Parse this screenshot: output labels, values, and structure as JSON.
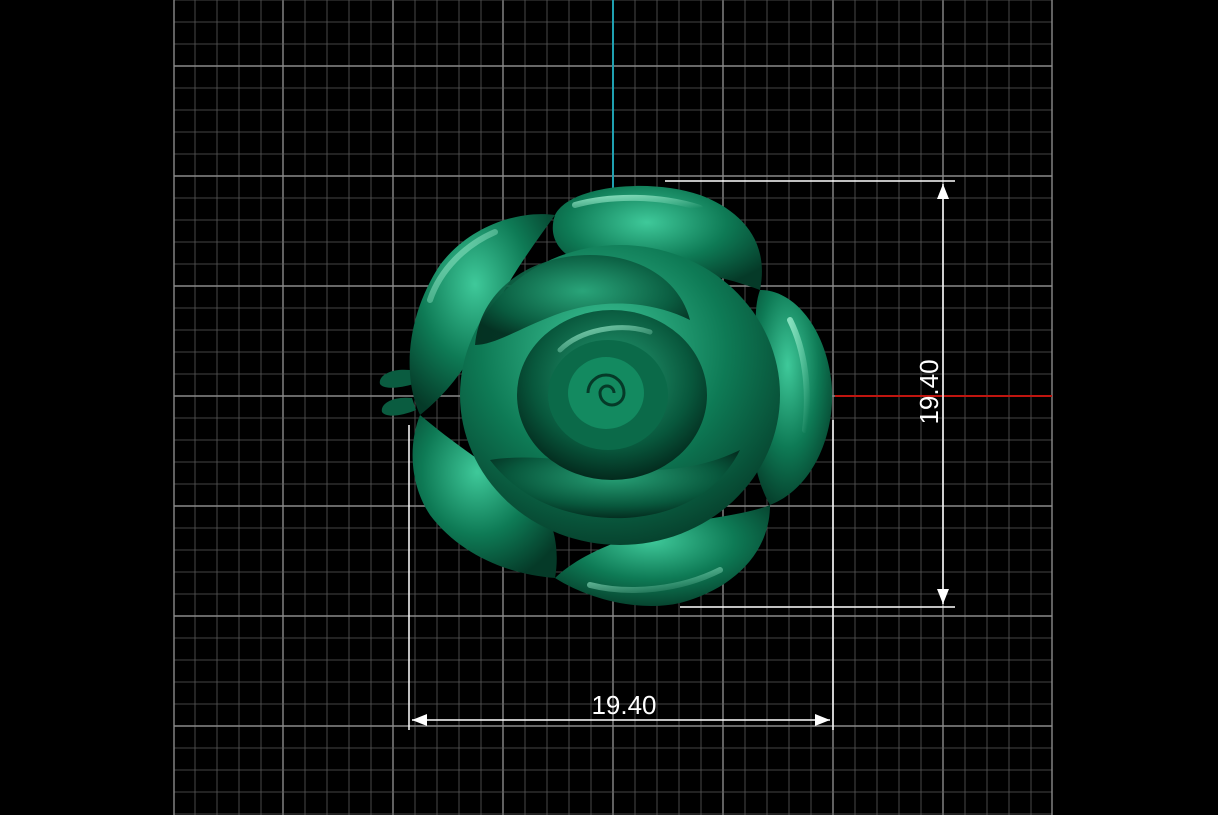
{
  "viewport": {
    "background": "#000000",
    "grid_color": "#5a5a5a",
    "grid_major_color": "#8a8a8a",
    "axis_x_color": "#c0150f",
    "axis_y_color": "#1fa0b0",
    "dimension_color": "#ffffff"
  },
  "model": {
    "name": "rose",
    "color": "#0e7a55"
  },
  "dimensions": {
    "width_label": "19.40",
    "height_label": "19.40"
  }
}
